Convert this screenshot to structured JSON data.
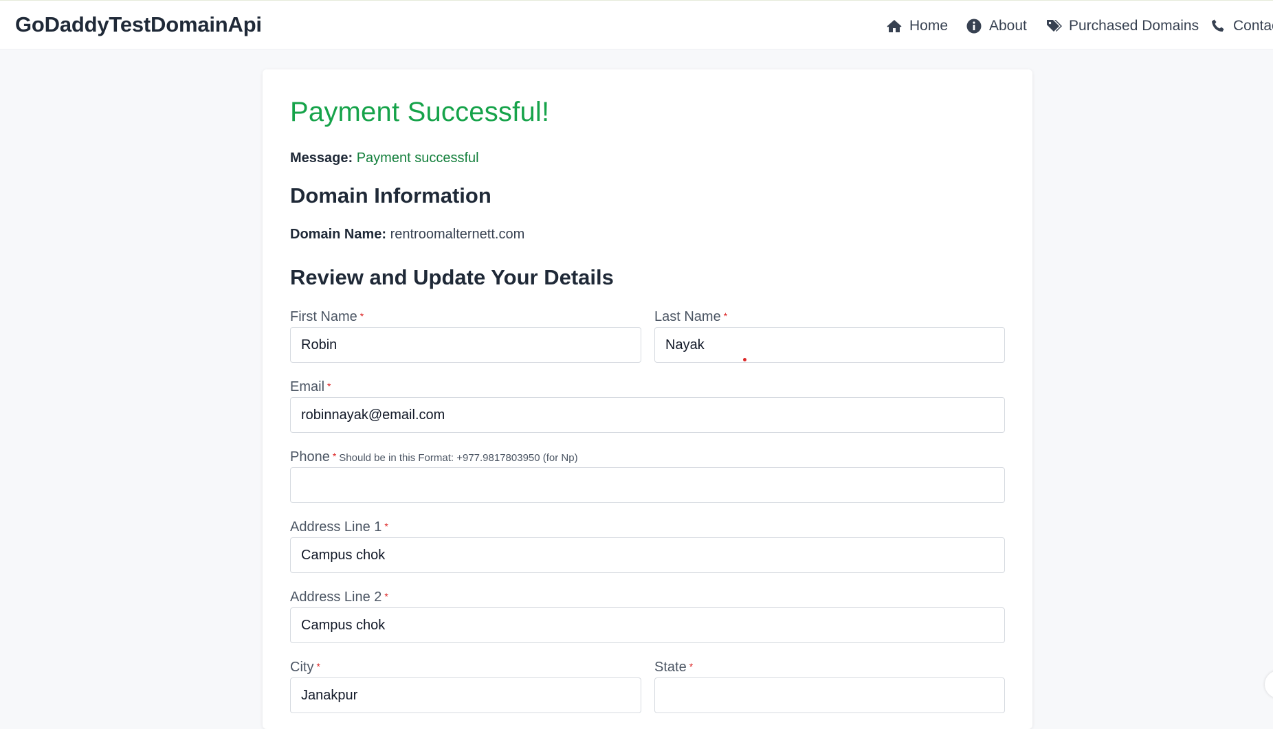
{
  "nav": {
    "brand": "GoDaddyTestDomainApi",
    "items": [
      {
        "label": "Home",
        "icon": "home-icon"
      },
      {
        "label": "About",
        "icon": "info-icon"
      },
      {
        "label": "Purchased Domains",
        "icon": "tags-icon"
      },
      {
        "label": "Contac",
        "icon": "phone-icon"
      }
    ]
  },
  "payment": {
    "title": "Payment Successful!",
    "message_label": "Message:",
    "message_value": "Payment successful"
  },
  "domain": {
    "heading": "Domain Information",
    "name_label": "Domain Name:",
    "name_value": "rentroomalternett.com"
  },
  "form": {
    "heading": "Review and Update Your Details",
    "required_mark": "*",
    "first_name": {
      "label": "First Name",
      "value": "Robin"
    },
    "last_name": {
      "label": "Last Name",
      "value": "Nayak"
    },
    "email": {
      "label": "Email",
      "value": "robinnayak@email.com"
    },
    "phone": {
      "label": "Phone",
      "hint": "Should be in this Format: +977.9817803950 (for Np)",
      "value": ""
    },
    "address1": {
      "label": "Address Line 1",
      "value": "Campus chok"
    },
    "address2": {
      "label": "Address Line 2",
      "value": "Campus chok"
    },
    "city": {
      "label": "City",
      "value": "Janakpur"
    },
    "state": {
      "label": "State",
      "value": ""
    }
  },
  "colors": {
    "success": "#16a34a",
    "required": "#dc2626",
    "text": "#1f2937"
  }
}
